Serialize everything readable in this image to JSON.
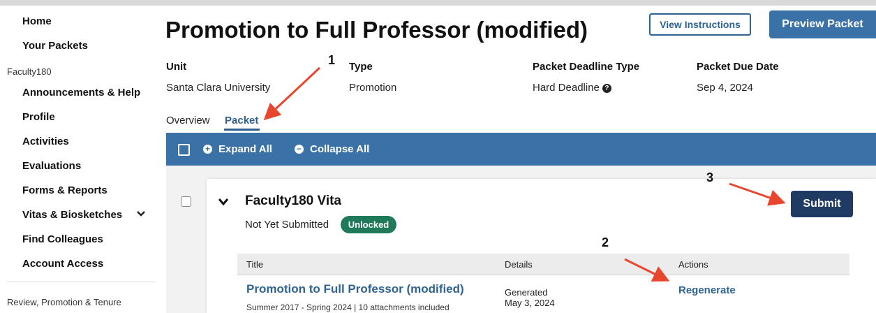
{
  "sidebar": {
    "items": [
      {
        "label": "Home"
      },
      {
        "label": "Your Packets"
      },
      {
        "label": "Announcements & Help"
      },
      {
        "label": "Profile"
      },
      {
        "label": "Activities"
      },
      {
        "label": "Evaluations"
      },
      {
        "label": "Forms & Reports"
      },
      {
        "label": "Vitas & Biosketches",
        "icon": "chevron-down-icon"
      },
      {
        "label": "Find Colleagues"
      },
      {
        "label": "Account Access"
      }
    ],
    "section_faculty": "Faculty180",
    "section_review": "Review, Promotion & Tenure"
  },
  "header": {
    "title": "Promotion to Full Professor (modified)",
    "view_instructions": "View Instructions",
    "preview_packet": "Preview Packet"
  },
  "meta": {
    "unit_label": "Unit",
    "unit_value": "Santa Clara University",
    "type_label": "Type",
    "type_value": "Promotion",
    "deadline_type_label": "Packet Deadline Type",
    "deadline_type_value": "Hard Deadline",
    "due_date_label": "Packet Due Date",
    "due_date_value": "Sep 4, 2024"
  },
  "tabs": [
    {
      "label": "Overview",
      "active": false
    },
    {
      "label": "Packet",
      "active": true
    }
  ],
  "toolbar": {
    "expand_all": "Expand All",
    "collapse_all": "Collapse All"
  },
  "section": {
    "title": "Faculty180 Vita",
    "status": "Not Yet Submitted",
    "badge": "Unlocked",
    "submit": "Submit",
    "table": {
      "headers": [
        "Title",
        "Details",
        "Actions"
      ],
      "row": {
        "title": "Promotion to Full Professor (modified)",
        "subtitle": "Summer 2017 - Spring 2024 | 10 attachments included",
        "details_line1": "Generated",
        "details_line2": "May 3, 2024",
        "action": "Regenerate"
      }
    }
  },
  "annotations": [
    "1",
    "2",
    "3"
  ],
  "colors": {
    "primary_blue": "#3a72a8",
    "link_blue": "#2e6494",
    "dark_navy": "#1f3a63",
    "badge_green": "#1f7a5a",
    "arrow_red": "#e8472e"
  }
}
